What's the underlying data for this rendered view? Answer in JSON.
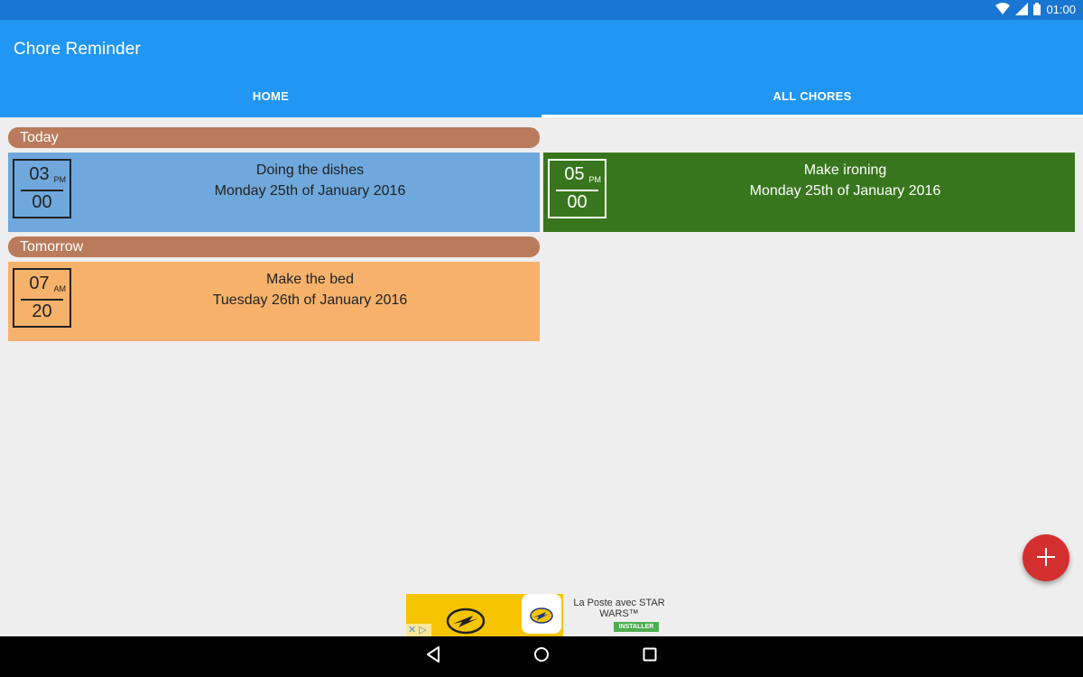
{
  "status_bar": {
    "time": "01:00"
  },
  "app": {
    "title": "Chore Reminder"
  },
  "tabs": [
    {
      "label": "HOME",
      "active": false
    },
    {
      "label": "ALL CHORES",
      "active": true
    }
  ],
  "sections": [
    {
      "label": "Today"
    },
    {
      "label": "Tomorrow"
    }
  ],
  "chores": [
    {
      "hour": "03",
      "ampm": "PM",
      "minute": "00",
      "title": "Doing the dishes",
      "date": "Monday 25th of January 2016",
      "color": "#6fa8dc",
      "text_color": "#222222"
    },
    {
      "hour": "05",
      "ampm": "PM",
      "minute": "00",
      "title": "Make ironing",
      "date": "Monday 25th of January 2016",
      "color": "#38761d",
      "text_color": "#ffffff"
    },
    {
      "hour": "07",
      "ampm": "AM",
      "minute": "20",
      "title": "Make the bed",
      "date": "Tuesday 26th of January 2016",
      "color": "#f6b26b",
      "text_color": "#222222"
    }
  ],
  "fab": {
    "icon": "plus-icon"
  },
  "ad": {
    "text": "La Poste avec STAR WARS™",
    "button": "INSTALLER"
  },
  "colors": {
    "primary": "#2196f3",
    "primary_dark": "#1976d2",
    "section": "#b97b5c",
    "accent": "#d32f2f"
  }
}
